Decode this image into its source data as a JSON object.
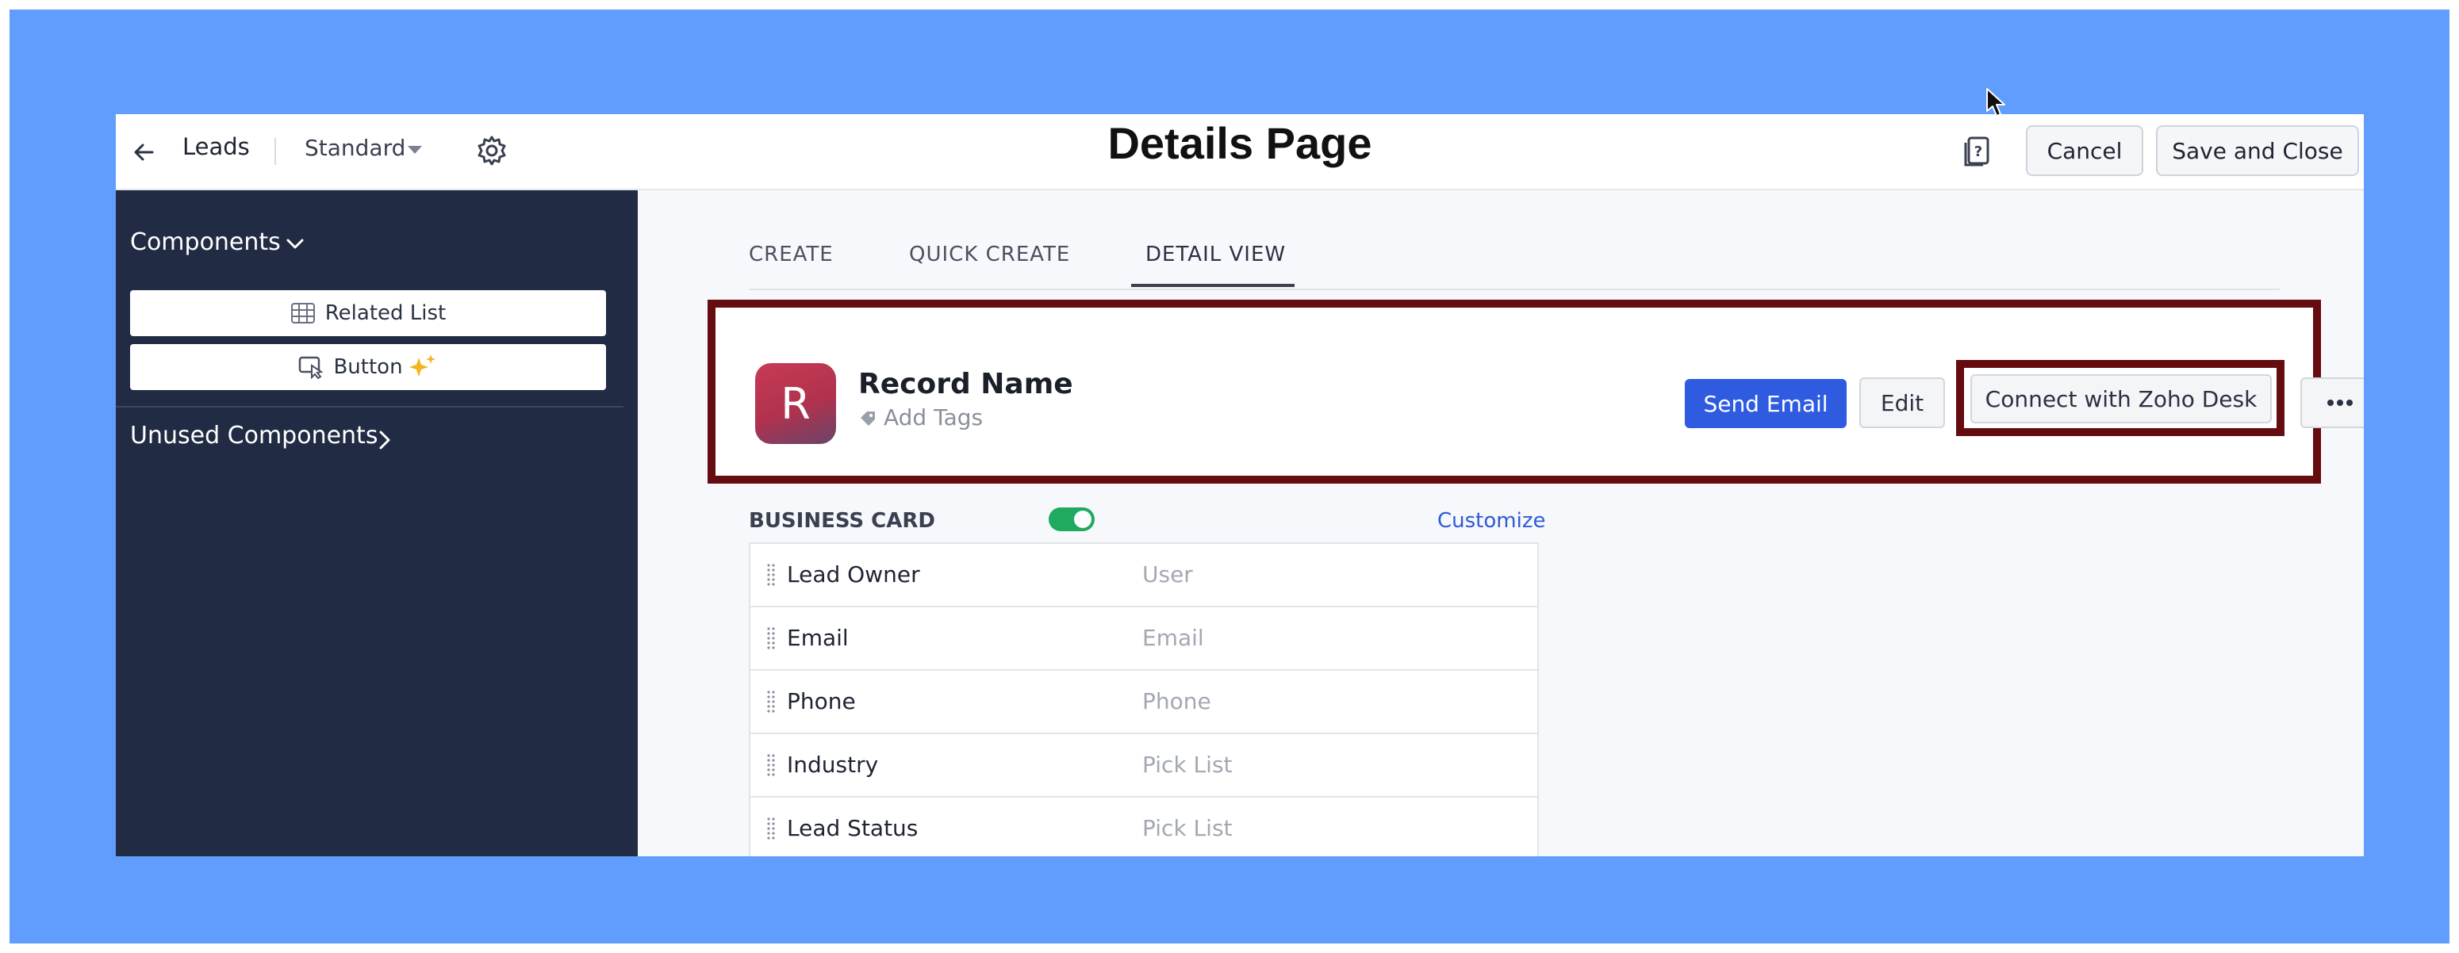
{
  "header": {
    "module": "Leads",
    "layout": "Standard",
    "page_title": "Details Page",
    "cancel_label": "Cancel",
    "save_label": "Save and Close"
  },
  "sidebar": {
    "components_label": "Components",
    "items": [
      {
        "label": "Related List",
        "icon": "table-icon"
      },
      {
        "label": "Button",
        "icon": "cursor-click-icon"
      }
    ],
    "unused_label": "Unused Components"
  },
  "tabs": [
    {
      "label": "CREATE",
      "active": false
    },
    {
      "label": "QUICK CREATE",
      "active": false
    },
    {
      "label": "DETAIL VIEW",
      "active": true
    }
  ],
  "record": {
    "avatar_letter": "R",
    "name": "Record Name",
    "tags_placeholder": "Add Tags",
    "actions": {
      "send_email": "Send Email",
      "edit": "Edit",
      "connect": "Connect with Zoho Desk"
    }
  },
  "business_card": {
    "label": "BUSINESS CARD",
    "enabled": true,
    "customize_label": "Customize",
    "fields": [
      {
        "label": "Lead Owner",
        "type": "User"
      },
      {
        "label": "Email",
        "type": "Email"
      },
      {
        "label": "Phone",
        "type": "Phone"
      },
      {
        "label": "Industry",
        "type": "Pick List"
      },
      {
        "label": "Lead Status",
        "type": "Pick List"
      }
    ]
  },
  "colors": {
    "background": "#619dfd",
    "sidebar": "#212c44",
    "primary": "#2f5be0",
    "highlight": "#650c10",
    "toggle_on": "#1faa5f"
  }
}
